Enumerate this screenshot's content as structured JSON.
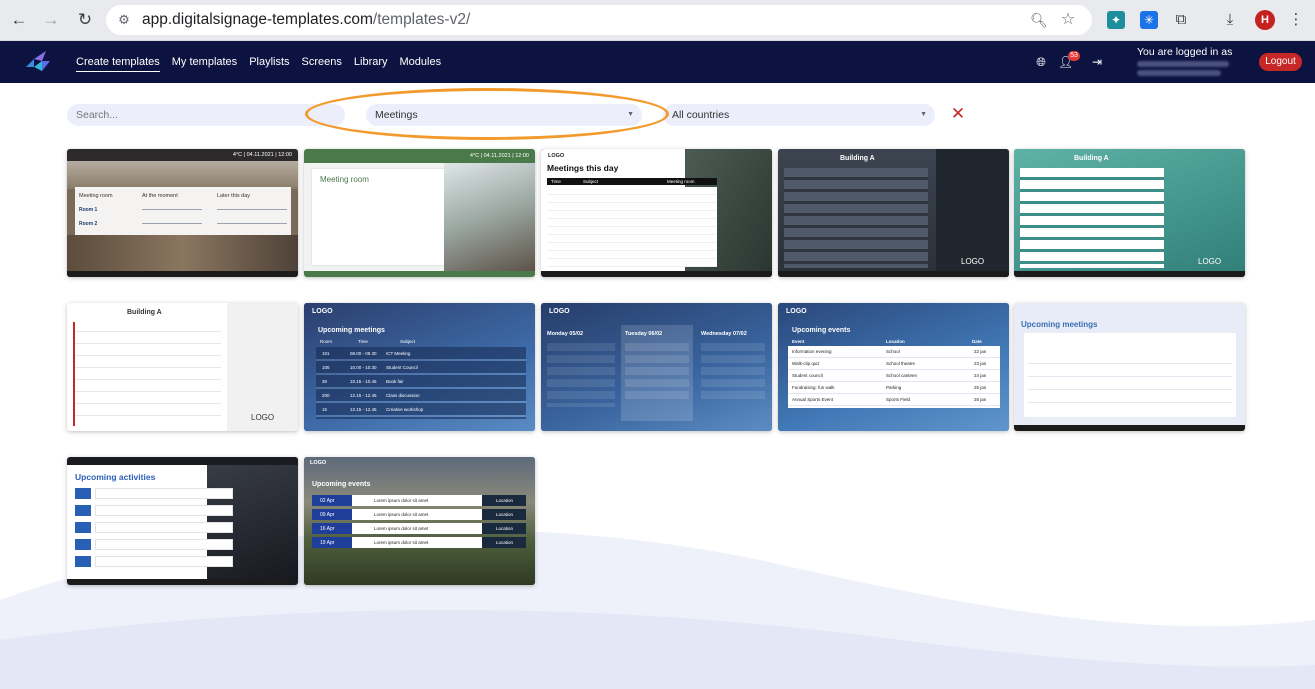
{
  "browser": {
    "url_host": "app.digitalsignage-templates.com",
    "url_path": "/templates-v2/",
    "profile_initial": "H"
  },
  "header": {
    "nav": [
      "Create templates",
      "My templates",
      "Playlists",
      "Screens",
      "Library",
      "Modules"
    ],
    "notification_count": "53",
    "logged_in_label": "You are logged in as",
    "logout_label": "Logout"
  },
  "filters": {
    "search_placeholder": "Search...",
    "category_value": "Meetings",
    "country_value": "All countries"
  },
  "cards": {
    "c1": {
      "time": "4°C | 04.11.2021 | 12:00",
      "col1": "Meeting room",
      "col2": "At the moment",
      "col3": "Later this day",
      "row1": "Room 1",
      "row2": "Room 2"
    },
    "c2": {
      "time": "4°C | 04.11.2021 | 12:00",
      "title": "Meeting room"
    },
    "c3": {
      "logo": "LOGO",
      "title": "Meetings this day",
      "h1": "Time",
      "h2": "Subject",
      "h3": "Meeting room"
    },
    "c4": {
      "title": "Building A",
      "logo": "LOGO"
    },
    "c5": {
      "title": "Building A",
      "logo": "LOGO"
    },
    "c6": {
      "title": "Building A",
      "logo": "LOGO"
    },
    "c7": {
      "logo": "LOGO",
      "title": "Upcoming meetings",
      "h1": "Room",
      "h2": "Time",
      "h3": "Subject",
      "rows": [
        {
          "room": "101",
          "time": "08.00 - 09.30",
          "subject": "ICT Meeting"
        },
        {
          "room": "105",
          "time": "10.00 - 10.30",
          "subject": "Student Council"
        },
        {
          "room": "30",
          "time": "10.15 - 10.45",
          "subject": "Book fair"
        },
        {
          "room": "200",
          "time": "12.15 - 12.45",
          "subject": "Class discussion"
        },
        {
          "room": "15",
          "time": "12.15 - 12.45",
          "subject": "Creative workshop"
        }
      ]
    },
    "c8": {
      "logo": "LOGO",
      "d1": "Monday 05/02",
      "d2": "Tuesday 06/02",
      "d3": "Wednesday 07/02"
    },
    "c9": {
      "logo": "LOGO",
      "title": "Upcoming events",
      "h1": "Event",
      "h2": "Location",
      "h3": "Date",
      "rows": [
        {
          "event": "Information evening",
          "location": "School",
          "date": "22 jan"
        },
        {
          "event": "Walk-clip quiz",
          "location": "School theatre",
          "date": "23 jan"
        },
        {
          "event": "Student council",
          "location": "School canteen",
          "date": "24 jan"
        },
        {
          "event": "Fundraising: fun walk",
          "location": "Parking",
          "date": "25 jan"
        },
        {
          "event": "Annual Sports Event",
          "location": "Sports Field",
          "date": "26 jan"
        }
      ]
    },
    "c10": {
      "title": "Upcoming meetings"
    },
    "c11": {
      "title": "Upcoming activities"
    },
    "c12": {
      "logo": "LOGO",
      "title": "Upcoming events",
      "rows": [
        {
          "date": "02 Apr",
          "text": "Lorem ipsum dolor sit amet",
          "loc": "Location"
        },
        {
          "date": "09 Apr",
          "text": "Lorem ipsum dolor sit amet",
          "loc": "Location"
        },
        {
          "date": "16 Apr",
          "text": "Lorem ipsum dolor sit amet",
          "loc": "Location"
        },
        {
          "date": "19 Apr",
          "text": "Lorem ipsum dolor sit amet",
          "loc": "Location"
        }
      ]
    }
  },
  "colors": {
    "appbar": "#0d1340",
    "accent_orange": "#f39a2d",
    "logout_red": "#c62828"
  }
}
